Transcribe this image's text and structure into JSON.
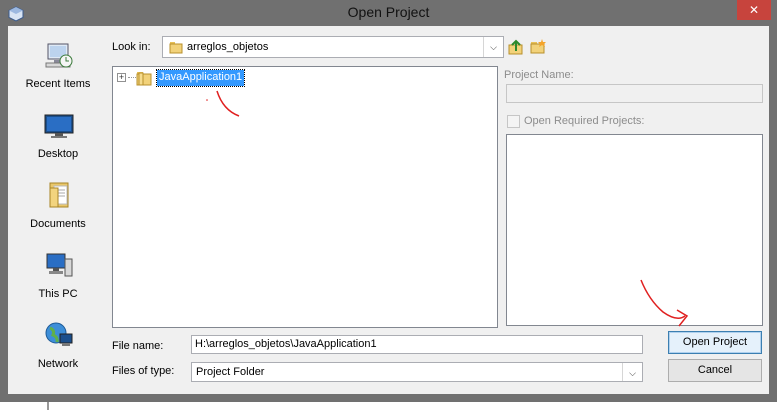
{
  "window": {
    "title": "Open Project",
    "close_glyph": "✕"
  },
  "places": [
    {
      "name": "recent-items",
      "label": "Recent Items",
      "icon": "recent-items-icon"
    },
    {
      "name": "desktop",
      "label": "Desktop",
      "icon": "desktop-icon"
    },
    {
      "name": "documents",
      "label": "Documents",
      "icon": "documents-icon"
    },
    {
      "name": "this-pc",
      "label": "This PC",
      "icon": "computer-icon"
    },
    {
      "name": "network",
      "label": "Network",
      "icon": "network-icon"
    }
  ],
  "look_in": {
    "label": "Look in:",
    "value": "arreglos_objetos"
  },
  "tree": {
    "expander": "+",
    "items": [
      {
        "label": "JavaApplication1",
        "selected": true
      }
    ]
  },
  "project_name": {
    "label": "Project Name:",
    "value": ""
  },
  "required_projects": {
    "label": "Open Required Projects:",
    "checked": false
  },
  "file_name": {
    "label": "File name:",
    "value": "H:\\arreglos_objetos\\JavaApplication1"
  },
  "files_of_type": {
    "label": "Files of type:",
    "value": "Project Folder"
  },
  "buttons": {
    "open": "Open Project",
    "cancel": "Cancel"
  },
  "colors": {
    "selection": "#3399ff",
    "title_bar": "#707070",
    "close": "#c7443d",
    "annotation": "#e02020"
  }
}
